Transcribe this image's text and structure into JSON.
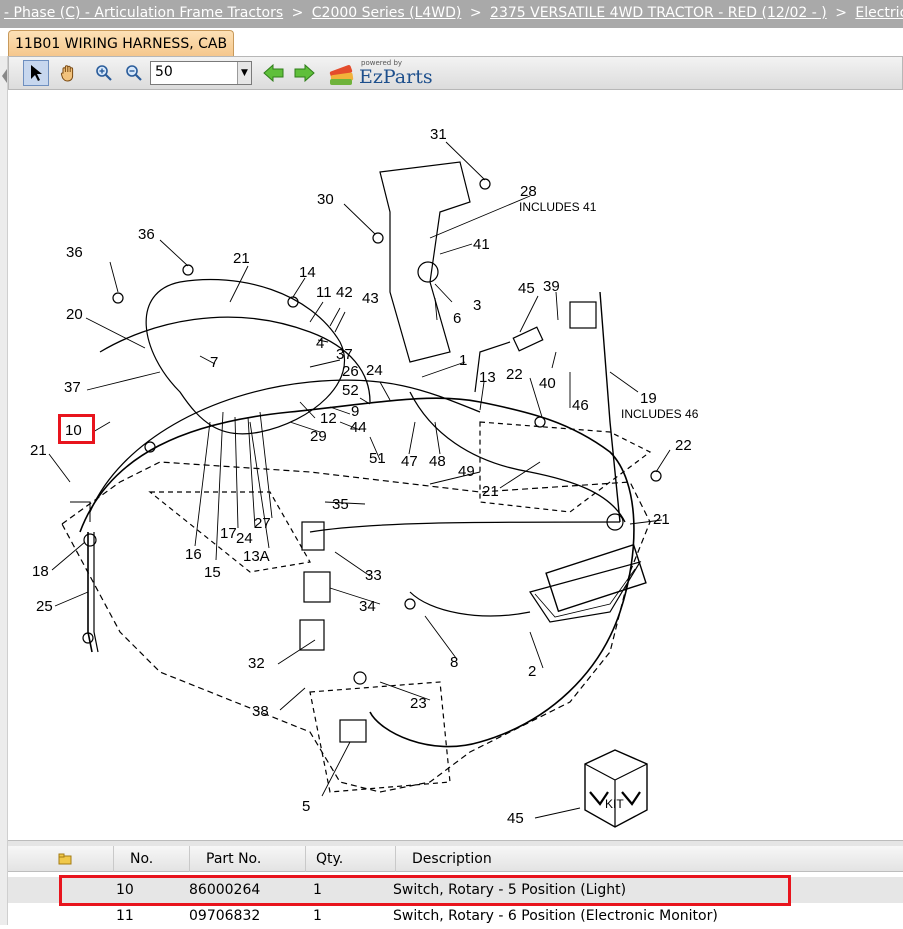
{
  "breadcrumb": {
    "items": [
      "- Phase (C) - Articulation Frame Tractors",
      "C2000 Series (L4WD)",
      "2375 VERSATILE 4WD TRACTOR - RED (12/02 - )",
      "Electrical -"
    ],
    "separator": ">"
  },
  "tab": {
    "label": "11B01 WIRING HARNESS, CAB"
  },
  "toolbar": {
    "zoom_value": "50",
    "logo_powered": "powered by",
    "logo_name": "EzParts",
    "icons": [
      "pointer-icon",
      "hand-icon",
      "zoom-in-icon",
      "zoom-out-icon",
      "back-arrow-icon",
      "forward-arrow-icon"
    ]
  },
  "diagram": {
    "callouts": [
      "31",
      "28",
      "30",
      "41",
      "36",
      "3",
      "21",
      "14",
      "11",
      "42",
      "43",
      "6",
      "45",
      "39",
      "20",
      "4",
      "1",
      "37",
      "7",
      "13",
      "22",
      "40",
      "19",
      "37",
      "26",
      "24",
      "52",
      "46",
      "10",
      "12",
      "9",
      "44",
      "29",
      "21",
      "51",
      "47",
      "48",
      "22",
      "49",
      "21",
      "35",
      "16",
      "17",
      "24",
      "27",
      "21",
      "18",
      "15",
      "13A",
      "33",
      "25",
      "34",
      "8",
      "2",
      "32",
      "23",
      "38",
      "5",
      "45"
    ],
    "notes": [
      "INCLUDES 41",
      "INCLUDES 46"
    ],
    "kit_label": "KIT"
  },
  "parts_table": {
    "headers": {
      "no": "No.",
      "part_no": "Part No.",
      "qty": "Qty.",
      "description": "Description"
    },
    "rows": [
      {
        "no": "10",
        "part_no": "86000264",
        "qty": "1",
        "description": "Switch, Rotary - 5 Position (Light)"
      },
      {
        "no": "11",
        "part_no": "09706832",
        "qty": "1",
        "description": "Switch, Rotary - 6 Position (Electronic Monitor)"
      }
    ]
  },
  "colors": {
    "highlight": "#e8141d",
    "breadcrumb_bg": "#a9a9a9",
    "tab_bg": "#f5c78d"
  }
}
